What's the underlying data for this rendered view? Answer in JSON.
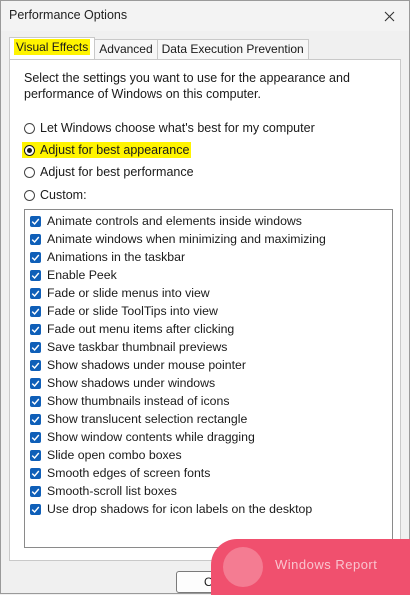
{
  "window": {
    "title": "Performance Options"
  },
  "tabs": [
    {
      "label": "Visual Effects"
    },
    {
      "label": "Advanced"
    },
    {
      "label": "Data Execution Prevention"
    }
  ],
  "description": "Select the settings you want to use for the appearance and performance of Windows on this computer.",
  "radios": [
    {
      "label": "Let Windows choose what's best for my computer",
      "checked": false
    },
    {
      "label": "Adjust for best appearance",
      "checked": true
    },
    {
      "label": "Adjust for best performance",
      "checked": false
    },
    {
      "label": "Custom:",
      "checked": false
    }
  ],
  "options": [
    {
      "label": "Animate controls and elements inside windows",
      "checked": true
    },
    {
      "label": "Animate windows when minimizing and maximizing",
      "checked": true
    },
    {
      "label": "Animations in the taskbar",
      "checked": true
    },
    {
      "label": "Enable Peek",
      "checked": true
    },
    {
      "label": "Fade or slide menus into view",
      "checked": true
    },
    {
      "label": "Fade or slide ToolTips into view",
      "checked": true
    },
    {
      "label": "Fade out menu items after clicking",
      "checked": true
    },
    {
      "label": "Save taskbar thumbnail previews",
      "checked": true
    },
    {
      "label": "Show shadows under mouse pointer",
      "checked": true
    },
    {
      "label": "Show shadows under windows",
      "checked": true
    },
    {
      "label": "Show thumbnails instead of icons",
      "checked": true
    },
    {
      "label": "Show translucent selection rectangle",
      "checked": true
    },
    {
      "label": "Show window contents while dragging",
      "checked": true
    },
    {
      "label": "Slide open combo boxes",
      "checked": true
    },
    {
      "label": "Smooth edges of screen fonts",
      "checked": true
    },
    {
      "label": "Smooth-scroll list boxes",
      "checked": true
    },
    {
      "label": "Use drop shadows for icon labels on the desktop",
      "checked": true
    }
  ],
  "buttons": {
    "ok_label": "O"
  },
  "watermark": {
    "text": "Windows Report"
  },
  "colors": {
    "highlight": "#fff400",
    "checkbox": "#0f5fb8",
    "watermark": "#f0506e"
  }
}
